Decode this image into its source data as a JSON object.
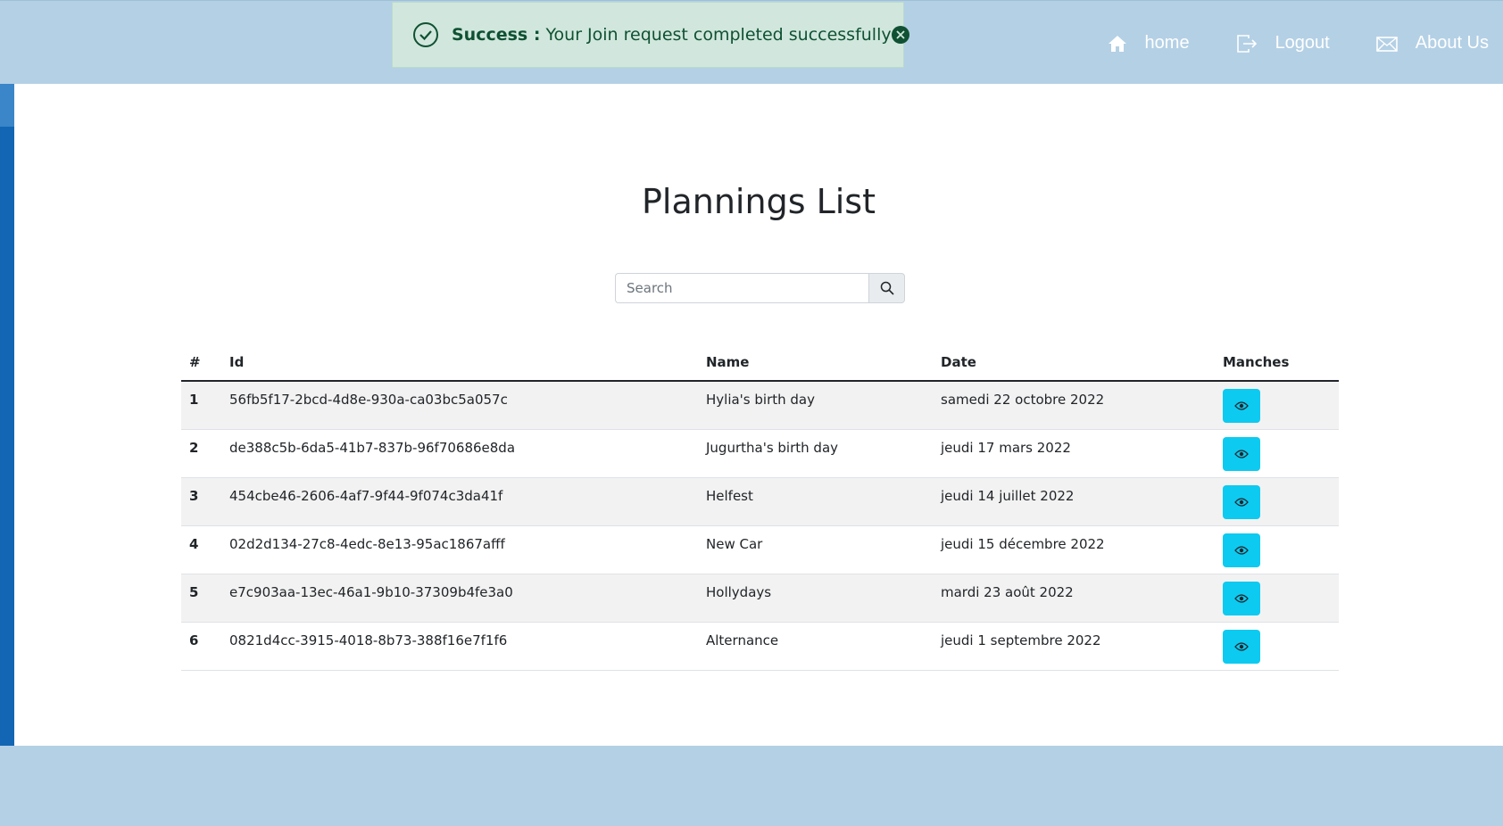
{
  "nav": {
    "links": [
      {
        "label": "home",
        "icon": "home-icon"
      },
      {
        "label": "Logout",
        "icon": "logout-icon"
      },
      {
        "label": "About Us",
        "icon": "envelope-icon"
      }
    ]
  },
  "alert": {
    "title": "Success :",
    "message": "Your Join request completed successfully",
    "icon": "check-circle-icon",
    "close_icon": "close-icon"
  },
  "page": {
    "title": "Plannings List"
  },
  "search": {
    "placeholder": "Search",
    "icon": "search-icon"
  },
  "table": {
    "headers": [
      "#",
      "Id",
      "Name",
      "Date",
      "Manches"
    ],
    "rows": [
      {
        "num": "1",
        "id": "56fb5f17-2bcd-4d8e-930a-ca03bc5a057c",
        "name": "Hylia's birth day",
        "date": "samedi 22 octobre 2022"
      },
      {
        "num": "2",
        "id": "de388c5b-6da5-41b7-837b-96f70686e8da",
        "name": "Jugurtha's birth day",
        "date": "jeudi 17 mars 2022"
      },
      {
        "num": "3",
        "id": "454cbe46-2606-4af7-9f44-9f074c3da41f",
        "name": "Helfest",
        "date": "jeudi 14 juillet 2022"
      },
      {
        "num": "4",
        "id": "02d2d134-27c8-4edc-8e13-95ac1867afff",
        "name": "New Car",
        "date": "jeudi 15 décembre 2022"
      },
      {
        "num": "5",
        "id": "e7c903aa-13ec-46a1-9b10-37309b4fe3a0",
        "name": "Hollydays",
        "date": "mardi 23 août 2022"
      },
      {
        "num": "6",
        "id": "0821d4cc-3915-4018-8b73-388f16e7f1f6",
        "name": "Alternance",
        "date": "jeudi 1 septembre 2022"
      }
    ],
    "view_icon": "eye-icon"
  },
  "colors": {
    "background": "#b4d0e5",
    "alert_bg": "#d1e7dd",
    "alert_text": "#0f5132",
    "view_button": "#0dcaf0",
    "left_bar": "#1266b4"
  }
}
